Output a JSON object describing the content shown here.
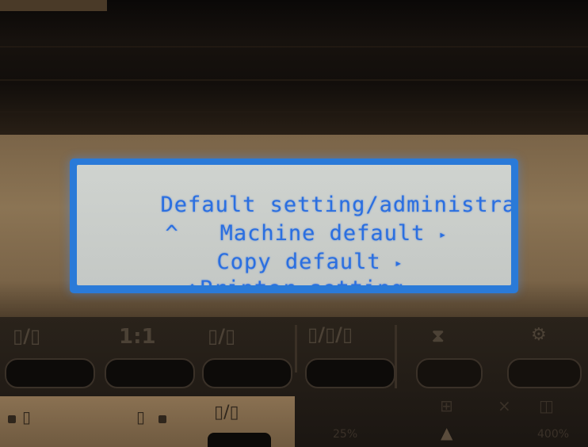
{
  "display": {
    "lines": [
      {
        "text": "Default setting/administrat",
        "marker": "",
        "arrow": ""
      },
      {
        "text": "Machine default",
        "marker": "^",
        "arrow": "▸"
      },
      {
        "text": "Copy default",
        "marker": "",
        "arrow": "▸"
      },
      {
        "text": "Printer setting",
        "marker": "◇",
        "arrow": "▸"
      }
    ]
  },
  "panel": {
    "key_labels": [
      "1:1"
    ],
    "zoom_labels": [
      "25%",
      "400%"
    ]
  },
  "colors": {
    "lcd_text": "#2b6fe0",
    "lcd_frame": "#2a7ad8",
    "lcd_background": "#c8ccc9",
    "bezel": "#8b7454"
  }
}
